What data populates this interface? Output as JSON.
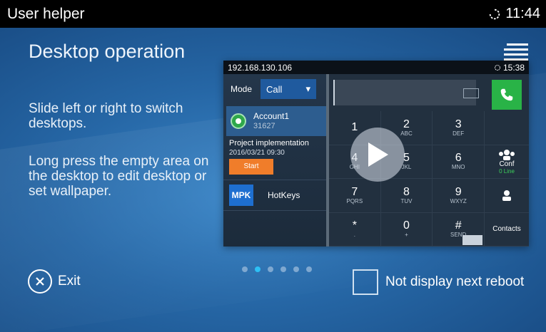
{
  "statusbar": {
    "app_title": "User helper",
    "time": "11:44"
  },
  "header": {
    "title": "Desktop operation",
    "menu_icon": "hamburger-icon"
  },
  "instructions": {
    "line1": "Slide left or right to switch desktops.",
    "line2": "Long press the empty area on the desktop to edit desktop or set wallpaper."
  },
  "preview": {
    "ip": "192.168.130.106",
    "time": "15:38",
    "mode_label": "Mode",
    "mode_value": "Call",
    "account_name": "Account1",
    "account_number": "31627",
    "meeting_title": "Project implementation",
    "meeting_time": "2016/03/21 09:30",
    "start_label": "Start",
    "mpk_badge": "MPK",
    "hotkeys_label": "HotKeys",
    "keys": [
      {
        "digit": "1",
        "letters": ""
      },
      {
        "digit": "2",
        "letters": "ABC"
      },
      {
        "digit": "3",
        "letters": "DEF"
      },
      {
        "digit": "4",
        "letters": "GHI"
      },
      {
        "digit": "5",
        "letters": "JKL"
      },
      {
        "digit": "6",
        "letters": "MNO"
      },
      {
        "digit": "7",
        "letters": "PQRS"
      },
      {
        "digit": "8",
        "letters": "TUV"
      },
      {
        "digit": "9",
        "letters": "WXYZ"
      },
      {
        "digit": "*",
        "letters": "."
      },
      {
        "digit": "0",
        "letters": "+"
      },
      {
        "digit": "#",
        "letters": "SEND"
      }
    ],
    "conf_label": "Conf",
    "conf_sub": "0 Line",
    "contacts_label": "Contacts"
  },
  "pagination": {
    "total": 6,
    "active_index": 1
  },
  "footer": {
    "exit_label": "Exit",
    "reboot_label": "Not display next reboot"
  },
  "colors": {
    "accent_dot": "#2dc0f5",
    "call_green": "#29b347",
    "start_orange": "#f07d2a"
  }
}
